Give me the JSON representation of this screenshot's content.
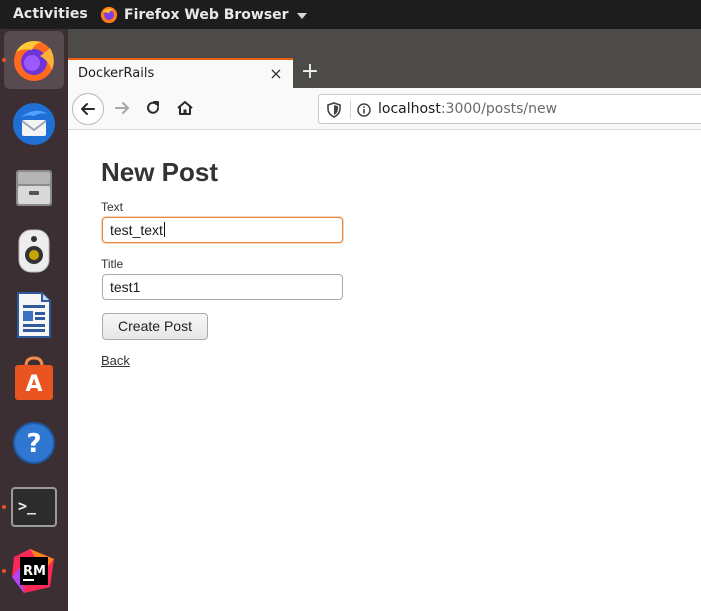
{
  "topbar": {
    "activities_label": "Activities",
    "app_name": "Firefox Web Browser"
  },
  "dock": {
    "items": [
      {
        "name": "Firefox",
        "icon": "firefox-icon",
        "active": true,
        "running": true
      },
      {
        "name": "Thunderbird",
        "icon": "thunderbird-icon"
      },
      {
        "name": "Files",
        "icon": "files-icon"
      },
      {
        "name": "Rhythmbox",
        "icon": "rhythmbox-icon"
      },
      {
        "name": "LibreOffice Writer",
        "icon": "writer-icon"
      },
      {
        "name": "Ubuntu Software",
        "icon": "software-icon",
        "glyph": "A"
      },
      {
        "name": "Help",
        "icon": "help-icon",
        "glyph": "?"
      },
      {
        "name": "Terminal",
        "icon": "terminal-icon",
        "running": true,
        "glyph": ">_"
      },
      {
        "name": "RubyMine",
        "icon": "rubymine-icon",
        "running": true,
        "glyph": "RM"
      }
    ]
  },
  "browser": {
    "tab_title": "DockerRails",
    "tab_close_glyph": "×",
    "new_tab_glyph": "+",
    "url_host": "localhost",
    "url_path": ":3000/posts/new"
  },
  "page": {
    "heading": "New Post",
    "text_label": "Text",
    "text_value": "test_text",
    "title_label": "Title",
    "title_value": "test1",
    "submit_label": "Create Post",
    "back_label": "Back"
  },
  "colors": {
    "accent": "#e95420",
    "focus_ring": "#e8873a",
    "dock_bg": "#3c2f33",
    "topbar_bg": "#1d1d1d"
  }
}
